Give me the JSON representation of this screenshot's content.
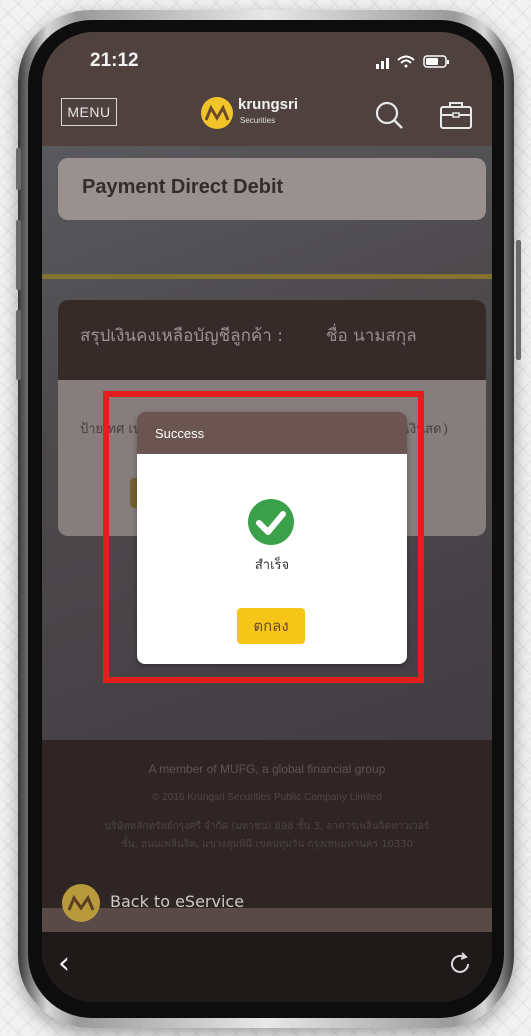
{
  "status_bar": {
    "time": "21:12"
  },
  "header": {
    "menu_label": "MENU",
    "logo_name": "krungsri",
    "logo_sub": "Securities",
    "icons": [
      "search-icon",
      "briefcase-icon"
    ]
  },
  "page": {
    "title": "Payment Direct Debit",
    "summary_title": "สรุปเงินคงเหลือบัญชีลูกค้า :",
    "summary_name": "ชื่อ นามสกุล",
    "col_left": "ป้าย/ทศ เประเภทบัญชี",
    "col_right": "Cash Amount (เงินสด)"
  },
  "footer": {
    "member": "A member of  MUFG, a global financial group",
    "copyright": "© 2016 Krungsri Securities Public Company Limited",
    "address": "บริษัทหลักทรัพย์กรุงศรี จำกัด (มหาชน) 898 ชั้น 3, อาคารเพลินจิตทาวเวอร์ชั้น, ถนนเพลินจิต, แขวงลุมพินี เขตปทุมวัน กรุงเทพมหานคร 10330",
    "back_label": "Back to eService"
  },
  "modal": {
    "title": "Success",
    "message": "สำเร็จ",
    "ok_label": "ตกลง",
    "icon": "check-circle-icon"
  },
  "colors": {
    "accent_yellow": "#f5c518",
    "header_brown": "#4e413e",
    "modal_header": "#6a5551",
    "success_green": "#3aa04a",
    "highlight_red": "#e41e1e"
  }
}
